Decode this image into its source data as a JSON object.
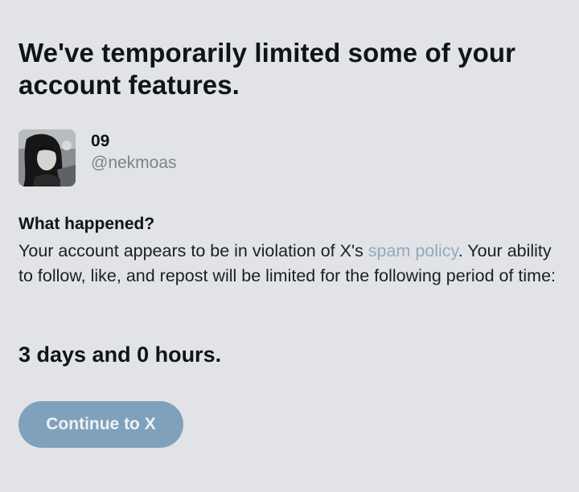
{
  "header": {
    "title": "We've temporarily limited some of your account features."
  },
  "account": {
    "display_name": "09",
    "handle": "@nekmoas"
  },
  "info": {
    "heading": "What happened?",
    "body_before": "Your account appears to be in violation of X's ",
    "policy_link": "spam policy",
    "body_after": ". Your ability to follow, like, and repost will be limited for the following period of time:"
  },
  "restriction": {
    "duration": "3 days and 0 hours."
  },
  "actions": {
    "continue_label": "Continue to X"
  },
  "colors": {
    "background": "#e1e3e6",
    "link": "#93aac0",
    "button": "#7fa1bc",
    "secondary_text": "#7b848d"
  }
}
